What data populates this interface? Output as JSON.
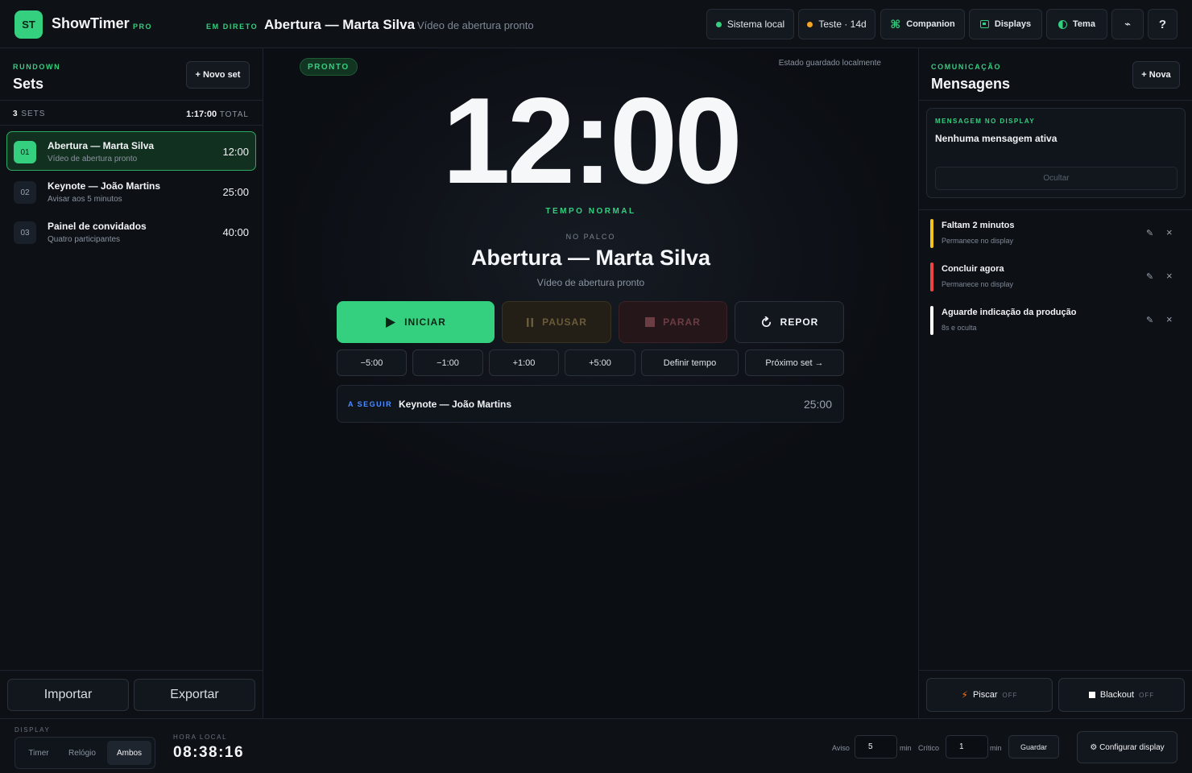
{
  "header": {
    "logo_initials": "ST",
    "brand": "ShowTimer",
    "brand_tag": "PRO",
    "live_label": "EM DIRETO",
    "live_title": "Abertura — Marta Silva",
    "live_subtitle": "Vídeo de abertura pronto",
    "buttons": {
      "system": "Sistema local",
      "trial": "Teste · 14d",
      "companion": "Companion",
      "displays": "Displays",
      "theme": "Tema",
      "misc": "⌁",
      "help": "?"
    },
    "colors": {
      "system_dot": "#34d07f",
      "trial_dot": "#f5a524"
    }
  },
  "rundown": {
    "eyebrow": "RUNDOWN",
    "title": "Sets",
    "new_button": "+ Novo set",
    "count_number": "3",
    "count_label": "SETS",
    "total_value": "1:17:00",
    "total_label": "TOTAL",
    "sets": [
      {
        "num": "01",
        "name": "Abertura — Marta Silva",
        "sub": "Vídeo de abertura pronto",
        "duration": "12:00",
        "active": true
      },
      {
        "num": "02",
        "name": "Keynote — João Martins",
        "sub": "Avisar aos 5 minutos",
        "duration": "25:00",
        "active": false
      },
      {
        "num": "03",
        "name": "Painel de convidados",
        "sub": "Quatro participantes",
        "duration": "40:00",
        "active": false
      }
    ],
    "import_button": "Importar",
    "export_button": "Exportar"
  },
  "timer": {
    "status_pill": "PRONTO",
    "saved_note": "Estado guardado localmente",
    "time": "12:00",
    "state_label": "TEMPO NORMAL",
    "stage_label": "NO PALCO",
    "stage_title": "Abertura — Marta Silva",
    "stage_subtitle": "Vídeo de abertura pronto",
    "controls": {
      "start": "INICIAR",
      "pause": "PAUSAR",
      "stop": "PARAR",
      "reset": "REPOR"
    },
    "adjust": {
      "minus5": "−5:00",
      "minus1": "−1:00",
      "plus1": "+1:00",
      "plus5": "+5:00",
      "set_time": "Definir tempo",
      "next_set": "Próximo set →"
    },
    "next": {
      "label": "A SEGUIR",
      "name": "Keynote — João Martins",
      "duration": "25:00"
    }
  },
  "messages": {
    "eyebrow": "COMUNICAÇÃO",
    "title": "Mensagens",
    "new_button": "+ Nova",
    "display_label": "MENSAGEM NO DISPLAY",
    "display_value": "Nenhuma mensagem ativa",
    "hide_button": "Ocultar",
    "items": [
      {
        "title": "Faltam 2 minutos",
        "sub": "Permanece no display",
        "color": "#f5c518"
      },
      {
        "title": "Concluir agora",
        "sub": "Permanece no display",
        "color": "#ef4444"
      },
      {
        "title": "Aguarde indicação da produção",
        "sub": "8s e oculta",
        "color": "#ffffff"
      }
    ],
    "flash_button": "Piscar",
    "flash_state": "OFF",
    "blackout_button": "Blackout",
    "blackout_state": "OFF"
  },
  "footer": {
    "display_label": "DISPLAY",
    "display_modes": [
      "Timer",
      "Relógio",
      "Ambos"
    ],
    "display_active": "Ambos",
    "clock_label": "HORA LOCAL",
    "clock": "08:38:16",
    "warning_label": "Aviso",
    "warning_value": "5",
    "critical_label": "Crítico",
    "critical_value": "1",
    "unit": "min",
    "save_button": "Guardar",
    "configure_button": "⚙ Configurar display"
  }
}
